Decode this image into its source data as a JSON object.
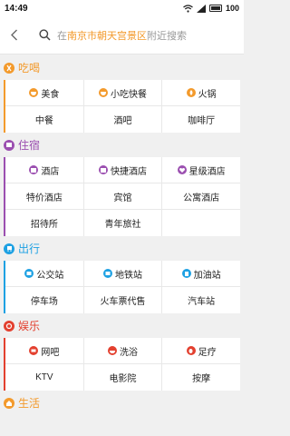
{
  "status": {
    "time": "14:49",
    "battery": "100"
  },
  "search": {
    "pre": "在",
    "highlight": "南京市朝天宫景区",
    "post": "附近搜索"
  },
  "colors": {
    "food": "#f39a2c",
    "stay": "#9b4fb0",
    "travel": "#1ea1e3",
    "fun": "#e3402f",
    "life": "#f39a2c"
  },
  "sections": {
    "food": {
      "title": "吃喝",
      "items": [
        [
          "美食",
          "小吃快餐",
          "火锅"
        ],
        [
          "中餐",
          "酒吧",
          "咖啡厅"
        ]
      ]
    },
    "stay": {
      "title": "住宿",
      "items": [
        [
          "酒店",
          "快捷酒店",
          "星级酒店"
        ],
        [
          "特价酒店",
          "宾馆",
          "公寓酒店"
        ],
        [
          "招待所",
          "青年旅社",
          ""
        ]
      ]
    },
    "travel": {
      "title": "出行",
      "items": [
        [
          "公交站",
          "地铁站",
          "加油站"
        ],
        [
          "停车场",
          "火车票代售",
          "汽车站"
        ]
      ]
    },
    "fun": {
      "title": "娱乐",
      "items": [
        [
          "网吧",
          "洗浴",
          "足疗"
        ],
        [
          "KTV",
          "电影院",
          "按摩"
        ]
      ]
    },
    "life": {
      "title": "生活"
    }
  }
}
